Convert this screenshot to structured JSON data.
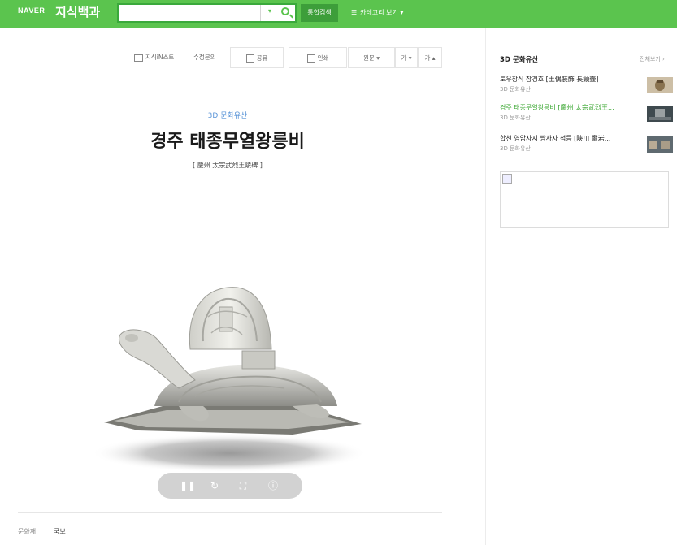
{
  "header": {
    "brand": "NAVER",
    "brand_sub": "지식백과",
    "search_value": "",
    "total_search": "통합검색",
    "category_menu": "카테고리 보기 ▾"
  },
  "toolbar": {
    "knowledge_list": "지식iN스트",
    "edit": "수정문의",
    "share": "공유",
    "print": "인쇄",
    "original": "원문 ▾",
    "font_down": "가 ▾",
    "font_up": "가 ▴"
  },
  "article": {
    "category": "3D 문화유산",
    "title": "경주 태종무열왕릉비",
    "hanja": "[ 慶州 太宗武烈王陵碑 ]",
    "meta_label": "문화재",
    "meta_value": "국보"
  },
  "sidebar": {
    "title": "3D 문화유산",
    "more": "전체보기 ›",
    "items": [
      {
        "name": "토우장식 장경호 [土偶裝飾 長頸壺]",
        "sub": "3D 문화유산"
      },
      {
        "name": "경주 태종무열왕릉비 [慶州 太宗武烈王...",
        "sub": "3D 문화유산"
      },
      {
        "name": "합천 영암사지 쌍사자 석등 [陜川 靈岩...",
        "sub": "3D 문화유산"
      }
    ]
  },
  "icons": [
    "search-icon",
    "dropdown-icon",
    "folder-icon",
    "share-icon",
    "print-icon",
    "pause-icon",
    "rotate-icon",
    "fullscreen-icon",
    "info-icon",
    "broken-image-icon"
  ],
  "colors": {
    "brand_green": "#5bc44e",
    "link_blue": "#5b95d8",
    "active_green": "#37a52e"
  }
}
